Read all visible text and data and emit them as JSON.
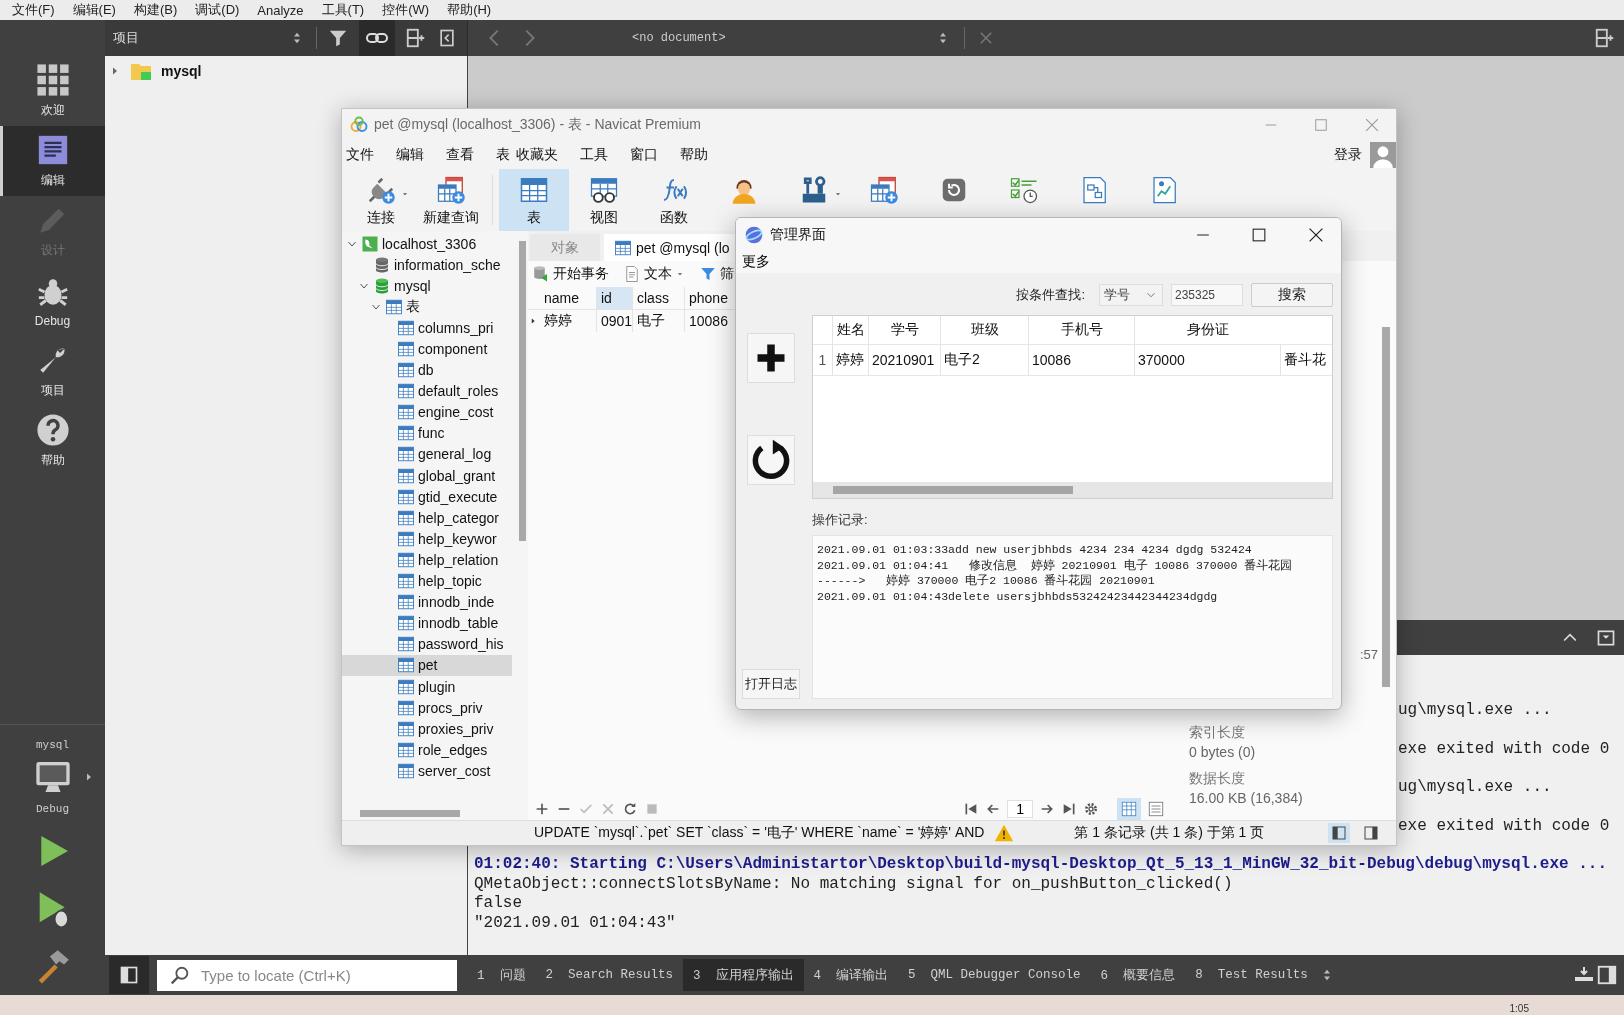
{
  "menu": [
    "文件(F)",
    "编辑(E)",
    "构建(B)",
    "调试(D)",
    "Analyze",
    "工具(T)",
    "控件(W)",
    "帮助(H)"
  ],
  "modes": [
    {
      "label": "欢迎",
      "selected": false,
      "disabled": false
    },
    {
      "label": "编辑",
      "selected": true,
      "disabled": false
    },
    {
      "label": "设计",
      "selected": false,
      "disabled": true
    },
    {
      "label": "Debug",
      "selected": false,
      "disabled": false
    },
    {
      "label": "项目",
      "selected": false,
      "disabled": false
    },
    {
      "label": "帮助",
      "selected": false,
      "disabled": false
    }
  ],
  "target": {
    "project": "mysql",
    "config": "Debug"
  },
  "project_pane": {
    "title": "项目",
    "tree": [
      {
        "label": "mysql",
        "expanded": false
      }
    ]
  },
  "editor": {
    "document": "<no document>"
  },
  "output": {
    "partial_lines": [
      "ug\\mysql.exe ...",
      "exe exited with code 0",
      "ug\\mysql.exe ...",
      "exe exited with code 0"
    ],
    "lines": [
      {
        "kind": "start",
        "text": "01:02:40: Starting C:\\Users\\Administartor\\Desktop\\build-mysql-Desktop_Qt_5_13_1_MinGW_32_bit-Debug\\debug\\mysql.exe ..."
      },
      {
        "kind": "plain",
        "text": "QMetaObject::connectSlotsByName: No matching signal for on_pushButton_clicked()"
      },
      {
        "kind": "plain",
        "text": "false"
      },
      {
        "kind": "plain",
        "text": "\"2021.09.01 01:04:43\""
      }
    ]
  },
  "locate": {
    "placeholder": "Type to locate (Ctrl+K)"
  },
  "output_tabs": [
    {
      "number": "1",
      "label": "问题",
      "selected": false
    },
    {
      "number": "2",
      "label": "Search Results",
      "selected": false
    },
    {
      "number": "3",
      "label": "应用程序输出",
      "selected": true
    },
    {
      "number": "4",
      "label": "编译输出",
      "selected": false
    },
    {
      "number": "5",
      "label": "QML Debugger Console",
      "selected": false
    },
    {
      "number": "6",
      "label": "概要信息",
      "selected": false
    },
    {
      "number": "8",
      "label": "Test Results",
      "selected": false
    }
  ],
  "taskbar": {
    "clock": "1:05"
  },
  "navicat": {
    "title": "pet @mysql (localhost_3306) - 表 - Navicat Premium",
    "menu": [
      "文件",
      "编辑",
      "查看",
      "表",
      "收藏夹",
      "工具",
      "窗口",
      "帮助"
    ],
    "login": "登录",
    "tools": [
      {
        "label": "连接",
        "selected": false
      },
      {
        "label": "新建查询",
        "selected": false
      },
      {
        "label": "表",
        "selected": true
      },
      {
        "label": "视图",
        "selected": false
      },
      {
        "label": "函数",
        "selected": false
      },
      {
        "selected": false
      },
      {
        "selected": false
      },
      {
        "selected": false
      },
      {
        "selected": false
      },
      {
        "selected": false
      },
      {
        "selected": false
      },
      {
        "selected": false
      }
    ],
    "tree": [
      {
        "label": "localhost_3306",
        "kind": "server",
        "expanded": true,
        "children": [
          {
            "label": "information_sche",
            "kind": "database"
          },
          {
            "label": "mysql",
            "kind": "database",
            "expanded": true,
            "children": [
              {
                "label": "表",
                "kind": "folder",
                "expanded": true,
                "children": [
                  {
                    "label": "columns_pri",
                    "kind": "table",
                    "selected": false
                  },
                  {
                    "label": "component",
                    "kind": "table",
                    "selected": false
                  },
                  {
                    "label": "db",
                    "kind": "table",
                    "selected": false
                  },
                  {
                    "label": "default_roles",
                    "kind": "table",
                    "selected": false
                  },
                  {
                    "label": "engine_cost",
                    "kind": "table",
                    "selected": false
                  },
                  {
                    "label": "func",
                    "kind": "table",
                    "selected": false
                  },
                  {
                    "label": "general_log",
                    "kind": "table",
                    "selected": false
                  },
                  {
                    "label": "global_grant",
                    "kind": "table",
                    "selected": false
                  },
                  {
                    "label": "gtid_execute",
                    "kind": "table",
                    "selected": false
                  },
                  {
                    "label": "help_categor",
                    "kind": "table",
                    "selected": false
                  },
                  {
                    "label": "help_keywor",
                    "kind": "table",
                    "selected": false
                  },
                  {
                    "label": "help_relation",
                    "kind": "table",
                    "selected": false
                  },
                  {
                    "label": "help_topic",
                    "kind": "table",
                    "selected": false
                  },
                  {
                    "label": "innodb_inde",
                    "kind": "table",
                    "selected": false
                  },
                  {
                    "label": "innodb_table",
                    "kind": "table",
                    "selected": false
                  },
                  {
                    "label": "password_his",
                    "kind": "table",
                    "selected": false
                  },
                  {
                    "label": "pet",
                    "kind": "table",
                    "selected": true
                  },
                  {
                    "label": "plugin",
                    "kind": "table",
                    "selected": false
                  },
                  {
                    "label": "procs_priv",
                    "kind": "table",
                    "selected": false
                  },
                  {
                    "label": "proxies_priv",
                    "kind": "table",
                    "selected": false
                  },
                  {
                    "label": "role_edges",
                    "kind": "table",
                    "selected": false
                  },
                  {
                    "label": "server_cost",
                    "kind": "table",
                    "selected": false
                  }
                ]
              }
            ]
          }
        ]
      }
    ],
    "tabs": [
      {
        "label": "对象",
        "selected": false
      },
      {
        "label": "pet @mysql (lo",
        "selected": true
      }
    ],
    "object_tools": [
      "开始事务",
      "文本",
      "筛"
    ],
    "grid": {
      "columns": [
        {
          "label": "name",
          "selected": false
        },
        {
          "label": "id",
          "selected": true
        },
        {
          "label": "class",
          "selected": false
        },
        {
          "label": "phone",
          "selected": false
        }
      ],
      "rows": [
        [
          "婷婷",
          "0901",
          "电子",
          "10086"
        ]
      ]
    },
    "info_partial": ":57",
    "info": [
      {
        "label": "索引长度",
        "value": "0 bytes (0)"
      },
      {
        "label": "数据长度",
        "value": "16.00 KB (16,384)"
      }
    ],
    "page": "1",
    "sql": "UPDATE `mysql`.`pet` SET `class` = '电子' WHERE `name` = '婷婷' AND",
    "records": "第 1 条记录 (共 1 条) 于第 1 页"
  },
  "dialog": {
    "title": "管理界面",
    "menu": [
      "更多"
    ],
    "search_label": "按条件查找:",
    "field": "学号",
    "query": "235325",
    "search_button": "搜索",
    "columns": [
      "姓名",
      "学号",
      "班级",
      "手机号",
      "身份证"
    ],
    "rows": [
      {
        "number": "1",
        "cells": [
          "婷婷",
          "20210901",
          "电子2",
          "10086",
          "370000",
          "番斗花"
        ]
      }
    ],
    "log_label": "操作记录:",
    "log": [
      "2021.09.01 01:03:33add new userjbhbds 4234 234 4234 dgdg 532424",
      "2021.09.01 01:04:41   修改信息  婷婷 20210901 电子 10086 370000 番斗花园",
      "------>   婷婷 370000 电子2 10086 番斗花园 20210901",
      "2021.09.01 01:04:43delete usersjbhbds53242423442344234dgdg"
    ],
    "open_log": "打开日志"
  }
}
